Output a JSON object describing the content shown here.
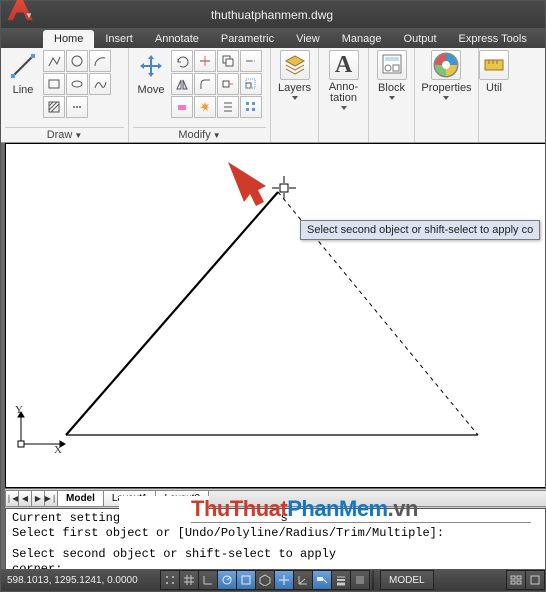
{
  "window": {
    "title": "thuthuatphanmem.dwg"
  },
  "tabs": {
    "t0": "Home",
    "t1": "Insert",
    "t2": "Annotate",
    "t3": "Parametric",
    "t4": "View",
    "t5": "Manage",
    "t6": "Output",
    "t7": "Express Tools"
  },
  "panel": {
    "draw": {
      "title": "Draw",
      "line": "Line"
    },
    "modify": {
      "title": "Modify",
      "move": "Move"
    },
    "layers": {
      "title": "Layers"
    },
    "anno": {
      "title": "Anno-\ntation"
    },
    "block": {
      "title": "Block"
    },
    "props": {
      "title": "Properties"
    },
    "util": {
      "title": "Util"
    }
  },
  "tooltip": {
    "text": "Select second object or shift-select to apply co"
  },
  "axis": {
    "x": "X",
    "y": "Y"
  },
  "sheets": {
    "s0": "Model",
    "s1": "Layout1",
    "s2": "Layout2"
  },
  "cmd": {
    "l0": "Current settings: Mode",
    "l0b": "s",
    "l1": "Select first object or [Undo/Polyline/Radius/Trim/Multiple]:",
    "l2": "Select second object or shift-select to apply corner:"
  },
  "status": {
    "coords": "598.1013, 1295.1241, 0.0000",
    "model": "MODEL"
  },
  "watermark": {
    "a": "ThuThuat",
    "b": "PhanMem",
    "c": ".vn"
  }
}
